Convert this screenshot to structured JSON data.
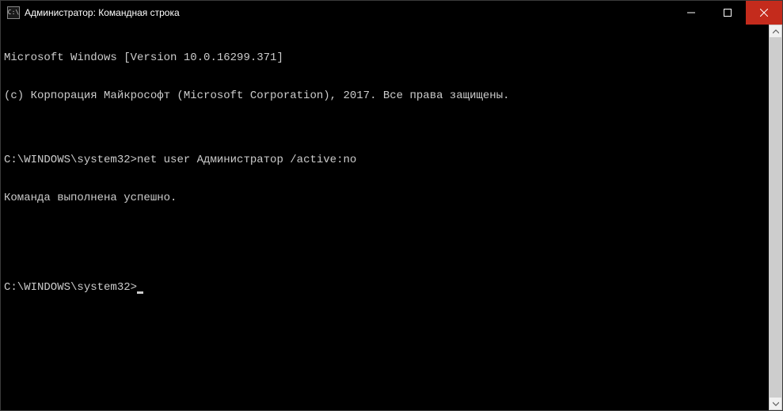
{
  "titlebar": {
    "icon_label": "C:\\",
    "title": "Администратор: Командная строка"
  },
  "terminal": {
    "line1": "Microsoft Windows [Version 10.0.16299.371]",
    "line2": "(c) Корпорация Майкрософт (Microsoft Corporation), 2017. Все права защищены.",
    "blank1": "",
    "prompt1_path": "C:\\WINDOWS\\system32>",
    "prompt1_command": "net user Администратор /active:no",
    "result1": "Команда выполнена успешно.",
    "blank2": "",
    "blank3": "",
    "prompt2_path": "C:\\WINDOWS\\system32>"
  }
}
